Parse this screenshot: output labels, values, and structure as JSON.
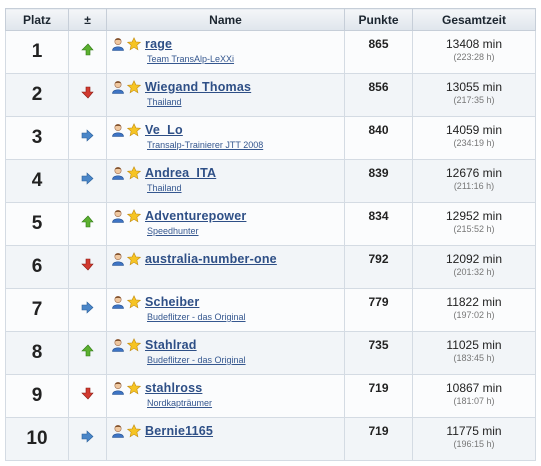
{
  "headers": {
    "rank": "Platz",
    "trend": "±",
    "name": "Name",
    "points": "Punkte",
    "time": "Gesamtzeit"
  },
  "colors": {
    "up": "#5cb030",
    "down": "#d23a30",
    "same": "#4a86c8",
    "link": "#2e4f86"
  },
  "rows": [
    {
      "rank": "1",
      "trend": "up",
      "trend_icon": "arrow-up-icon",
      "name": "rage",
      "team": "Team TransAlp-LeXXi",
      "points": "865",
      "time": "13408 min",
      "time_hm": "(223:28 h)"
    },
    {
      "rank": "2",
      "trend": "down",
      "trend_icon": "arrow-down-icon",
      "name": "Wiegand Thomas",
      "team": "Thailand",
      "points": "856",
      "time": "13055 min",
      "time_hm": "(217:35 h)"
    },
    {
      "rank": "3",
      "trend": "same",
      "trend_icon": "arrow-right-icon",
      "name": "Ve_Lo",
      "team": "Transalp-Trainierer JTT 2008",
      "points": "840",
      "time": "14059 min",
      "time_hm": "(234:19 h)"
    },
    {
      "rank": "4",
      "trend": "same",
      "trend_icon": "arrow-right-icon",
      "name": "Andrea_ITA",
      "team": "Thailand",
      "points": "839",
      "time": "12676 min",
      "time_hm": "(211:16 h)"
    },
    {
      "rank": "5",
      "trend": "up",
      "trend_icon": "arrow-up-icon",
      "name": "Adventurepower",
      "team": "Speedhunter",
      "points": "834",
      "time": "12952 min",
      "time_hm": "(215:52 h)"
    },
    {
      "rank": "6",
      "trend": "down",
      "trend_icon": "arrow-down-icon",
      "name": "australia-number-one",
      "team": "",
      "points": "792",
      "time": "12092 min",
      "time_hm": "(201:32 h)"
    },
    {
      "rank": "7",
      "trend": "same",
      "trend_icon": "arrow-right-icon",
      "name": "Scheiber",
      "team": "Budeflitzer - das Original",
      "points": "779",
      "time": "11822 min",
      "time_hm": "(197:02 h)"
    },
    {
      "rank": "8",
      "trend": "up",
      "trend_icon": "arrow-up-icon",
      "name": "Stahlrad",
      "team": "Budeflitzer - das Original",
      "points": "735",
      "time": "11025 min",
      "time_hm": "(183:45 h)"
    },
    {
      "rank": "9",
      "trend": "down",
      "trend_icon": "arrow-down-icon",
      "name": "stahlross",
      "team": "Nordkapträumer",
      "points": "719",
      "time": "10867 min",
      "time_hm": "(181:07 h)"
    },
    {
      "rank": "10",
      "trend": "same",
      "trend_icon": "arrow-right-icon",
      "name": "Bernie1165",
      "team": "",
      "points": "719",
      "time": "11775 min",
      "time_hm": "(196:15 h)"
    }
  ]
}
